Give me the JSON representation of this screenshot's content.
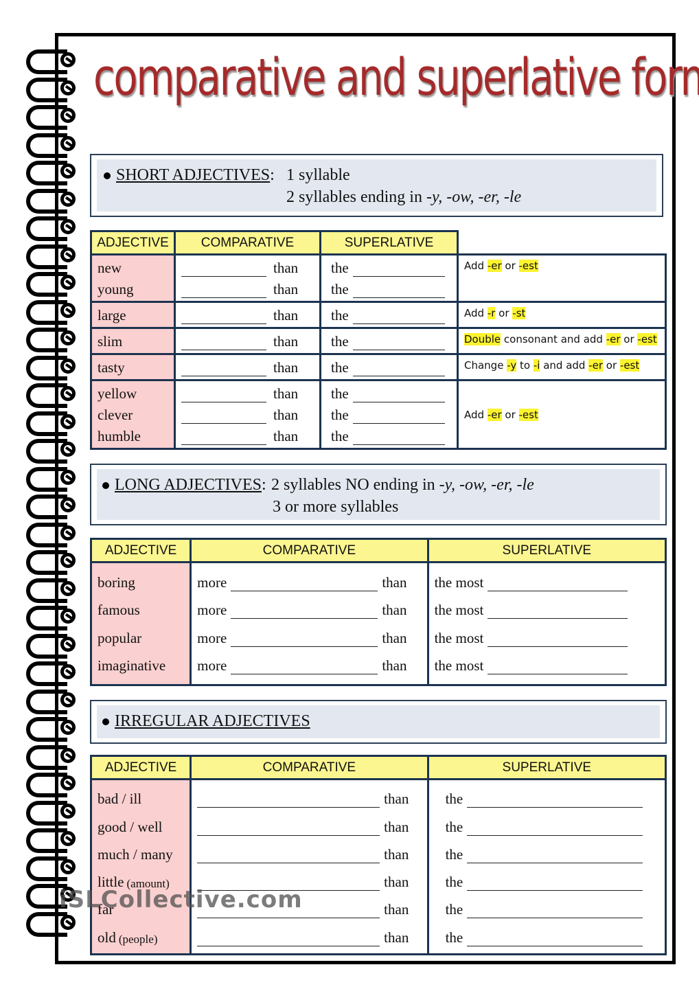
{
  "title": "comparative and superlative forms",
  "short": {
    "heading": "SHORT ADJECTIVES",
    "colon": ":",
    "line1": "1 syllable",
    "line2_prefix": "2 syllables ending in ",
    "line2_endings": "-y, -ow, -er, -le",
    "headers": [
      "ADJECTIVE",
      "COMPARATIVE",
      "SUPERLATIVE"
    ],
    "than": "than",
    "the": "the",
    "groups": [
      {
        "adjectives": [
          "new",
          "young"
        ],
        "rule": [
          {
            "t": "Add ",
            "hl": false
          },
          {
            "t": "-er",
            "hl": true
          },
          {
            "t": " or ",
            "hl": false
          },
          {
            "t": "-est",
            "hl": true
          }
        ]
      },
      {
        "adjectives": [
          "large"
        ],
        "rule": [
          {
            "t": "Add ",
            "hl": false
          },
          {
            "t": "-r",
            "hl": true
          },
          {
            "t": " or ",
            "hl": false
          },
          {
            "t": "-st",
            "hl": true
          }
        ]
      },
      {
        "adjectives": [
          "slim"
        ],
        "rule": [
          {
            "t": "Double",
            "hl": true
          },
          {
            "t": " consonant and add ",
            "hl": false
          },
          {
            "t": "-er",
            "hl": true
          },
          {
            "t": " or ",
            "hl": false
          },
          {
            "t": "-est",
            "hl": true
          }
        ]
      },
      {
        "adjectives": [
          "tasty"
        ],
        "rule": [
          {
            "t": "Change ",
            "hl": false
          },
          {
            "t": "-y",
            "hl": true
          },
          {
            "t": " to ",
            "hl": false
          },
          {
            "t": "-i",
            "hl": true
          },
          {
            "t": " and add ",
            "hl": false
          },
          {
            "t": "-er",
            "hl": true
          },
          {
            "t": " or ",
            "hl": false
          },
          {
            "t": "-est",
            "hl": true
          }
        ]
      },
      {
        "adjectives": [
          "yellow",
          "clever",
          "humble"
        ],
        "rule": [
          {
            "t": "Add ",
            "hl": false
          },
          {
            "t": "-er",
            "hl": true
          },
          {
            "t": " or ",
            "hl": false
          },
          {
            "t": "-est",
            "hl": true
          }
        ]
      }
    ]
  },
  "long": {
    "heading": "LONG ADJECTIVES",
    "colon": ":",
    "line1_prefix": "2 syllables NO ending in ",
    "line1_endings": "-y, -ow, -er, -le",
    "line2": "3 or more syllables",
    "headers": [
      "ADJECTIVE",
      "COMPARATIVE",
      "SUPERLATIVE"
    ],
    "more": "more",
    "than": "than",
    "the_most": "the most",
    "adjectives": [
      "boring",
      "famous",
      "popular",
      "imaginative"
    ]
  },
  "irregular": {
    "heading": "IRREGULAR ADJECTIVES",
    "headers": [
      "ADJECTIVE",
      "COMPARATIVE",
      "SUPERLATIVE"
    ],
    "than": "than",
    "the": "the",
    "adjectives": [
      {
        "word": "bad / ill",
        "note": ""
      },
      {
        "word": "good / well",
        "note": ""
      },
      {
        "word": "much / many",
        "note": ""
      },
      {
        "word": "little",
        "note": "(amount)"
      },
      {
        "word": "far",
        "note": ""
      },
      {
        "word": "old",
        "note": "(people)"
      }
    ]
  },
  "watermark": "iSLCollective.com",
  "colors": {
    "title": "#a52a2a",
    "header_fill": "#fbf68f",
    "adjective_fill": "#fbd0d0",
    "highlight": "#fbf32e",
    "info_fill": "#e3e8f0",
    "border": "#1c3350"
  }
}
